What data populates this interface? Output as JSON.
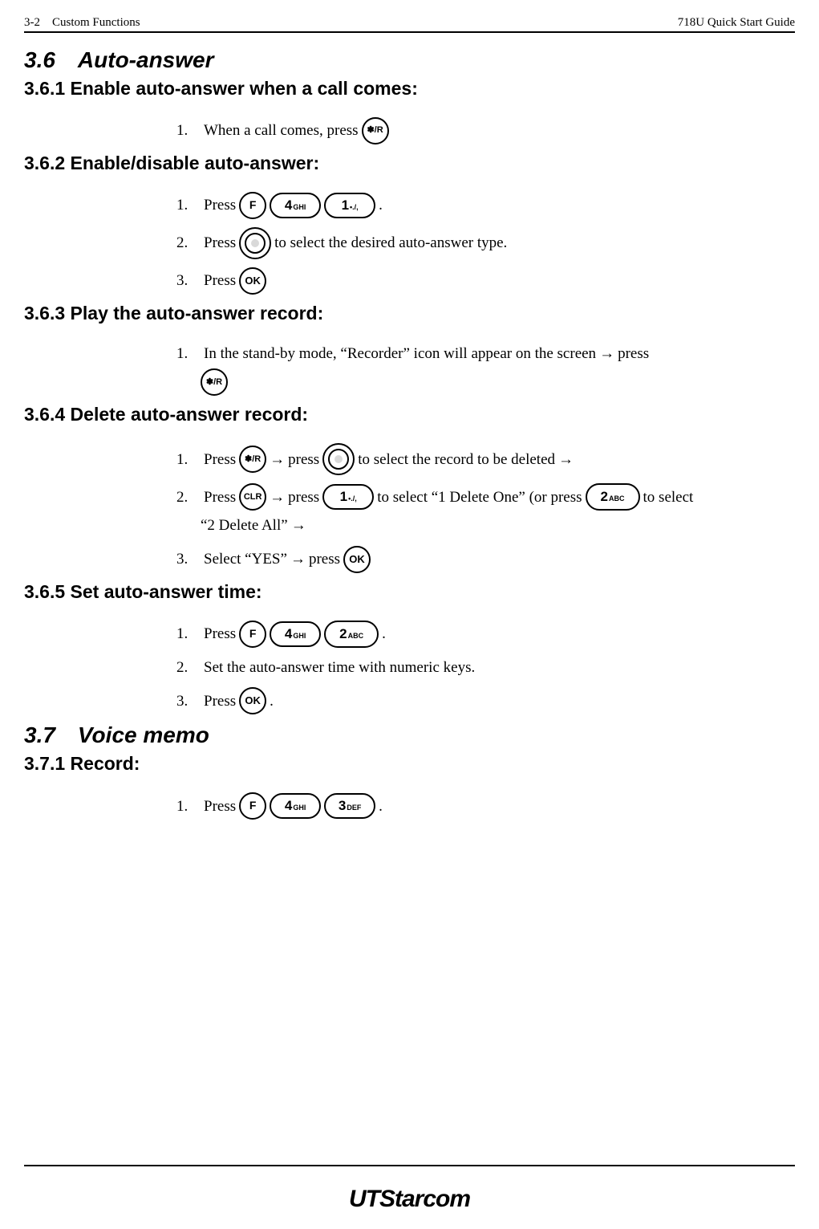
{
  "header": {
    "left": "3-2 Custom Functions",
    "right": "718U Quick Start Guide"
  },
  "sec36": {
    "title": "3.6 Auto-answer",
    "s1": {
      "title": "3.6.1 Enable auto-answer when a call comes:",
      "i1_num": "1.",
      "i1_text": "When a call comes, press"
    },
    "s2": {
      "title": "3.6.2 Enable/disable auto-answer:",
      "i1_num": "1.",
      "i1_text": "Press",
      "i1_end": ".",
      "i2_num": "2.",
      "i2_text": "Press",
      "i2_end": "to select the desired auto-answer type.",
      "i3_num": "3.",
      "i3_text": "Press"
    },
    "s3": {
      "title": "3.6.3 Play the auto-answer record:",
      "i1_num": "1.",
      "i1_text": "In the stand-by mode, “Recorder” icon will appear on the screen",
      "i1_arrow": "→",
      "i1_press": "press"
    },
    "s4": {
      "title": "3.6.4 Delete auto-answer record:",
      "i1_num": "1.",
      "i1_a": "Press",
      "i1_b": "press",
      "i1_c": "to select the record to be deleted",
      "i2_num": "2.",
      "i2_a": "Press",
      "i2_b": "press",
      "i2_c": "to select “1 Delete One” (or press",
      "i2_d": "to select",
      "i2_e": "“2 Delete All”",
      "i3_num": "3.",
      "i3_a": "Select “YES”",
      "i3_b": "press",
      "arrow": "→"
    },
    "s5": {
      "title": "3.6.5 Set auto-answer time:",
      "i1_num": "1.",
      "i1_text": "Press",
      "i1_end": ".",
      "i2_num": "2.",
      "i2_text": "Set the auto-answer time with numeric keys.",
      "i3_num": "3.",
      "i3_text": "Press",
      "i3_end": "."
    }
  },
  "sec37": {
    "title": "3.7 Voice memo",
    "s1": {
      "title": "3.7.1 Record:",
      "i1_num": "1.",
      "i1_text": "Press",
      "i1_end": "."
    }
  },
  "keys": {
    "record": "✽/R",
    "F": "F",
    "4_big": "4",
    "4_small": "GHI",
    "1_big": "1",
    "1_small": "•./,",
    "2_big": "2",
    "2_small": "ABC",
    "3_big": "3",
    "3_small": "DEF",
    "OK": "OK",
    "CLR": "CLR"
  },
  "footer": {
    "logo_a": "UT",
    "logo_b": "Starcom"
  }
}
